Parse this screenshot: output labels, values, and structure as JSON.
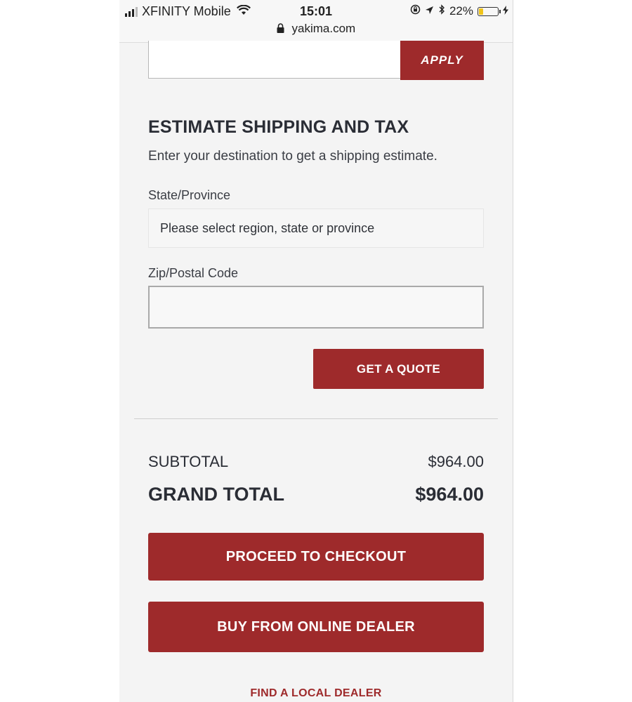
{
  "status_bar": {
    "carrier": "XFINITY Mobile",
    "time": "15:01",
    "url": "yakima.com",
    "battery": "22%",
    "battery_level": 0.22,
    "battery_color": "#f0c419"
  },
  "coupon": {
    "input_value": "",
    "apply_label": "APPLY"
  },
  "shipping": {
    "title": "ESTIMATE SHIPPING AND TAX",
    "description": "Enter your destination to get a shipping estimate.",
    "state_label": "State/Province",
    "state_placeholder": "Please select region, state or province",
    "zip_label": "Zip/Postal Code",
    "zip_value": "",
    "quote_label": "GET A QUOTE"
  },
  "totals": {
    "subtotal_label": "SUBTOTAL",
    "subtotal_value": "$964.00",
    "grand_label": "GRAND TOTAL",
    "grand_value": "$964.00"
  },
  "actions": {
    "checkout_label": "PROCEED TO CHECKOUT",
    "online_dealer_label": "BUY FROM ONLINE DEALER",
    "local_dealer_label": "FIND A LOCAL DEALER"
  },
  "theme": {
    "accent": "#9e2a2b"
  },
  "icons": {
    "signal": "cellular-signal-icon",
    "wifi": "wifi-icon",
    "lock": "lock-icon",
    "lock_rotation": "orientation-lock-icon",
    "location": "location-arrow-icon",
    "bluetooth": "bluetooth-icon",
    "battery": "battery-icon",
    "charging": "charging-bolt-icon"
  }
}
